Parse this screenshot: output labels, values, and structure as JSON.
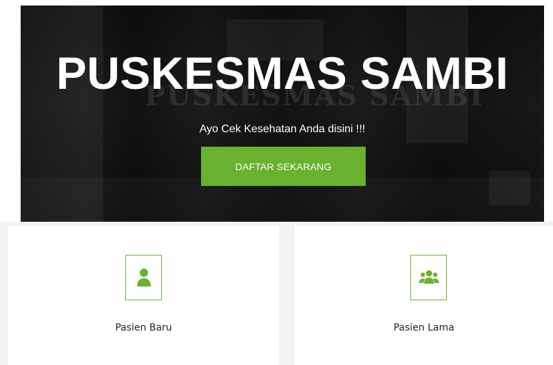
{
  "hero": {
    "title": "PUSKESMAS SAMBI",
    "subtitle": "Ayo Cek Kesehatan Anda disini !!!",
    "cta_label": "DAFTAR SEKARANG"
  },
  "cards": [
    {
      "label": "Pasien Baru",
      "icon": "user-icon"
    },
    {
      "label": "Pasien Lama",
      "icon": "users-icon"
    }
  ],
  "colors": {
    "accent": "#6ab12f",
    "hero_bg": "#161616",
    "text": "#222222"
  }
}
